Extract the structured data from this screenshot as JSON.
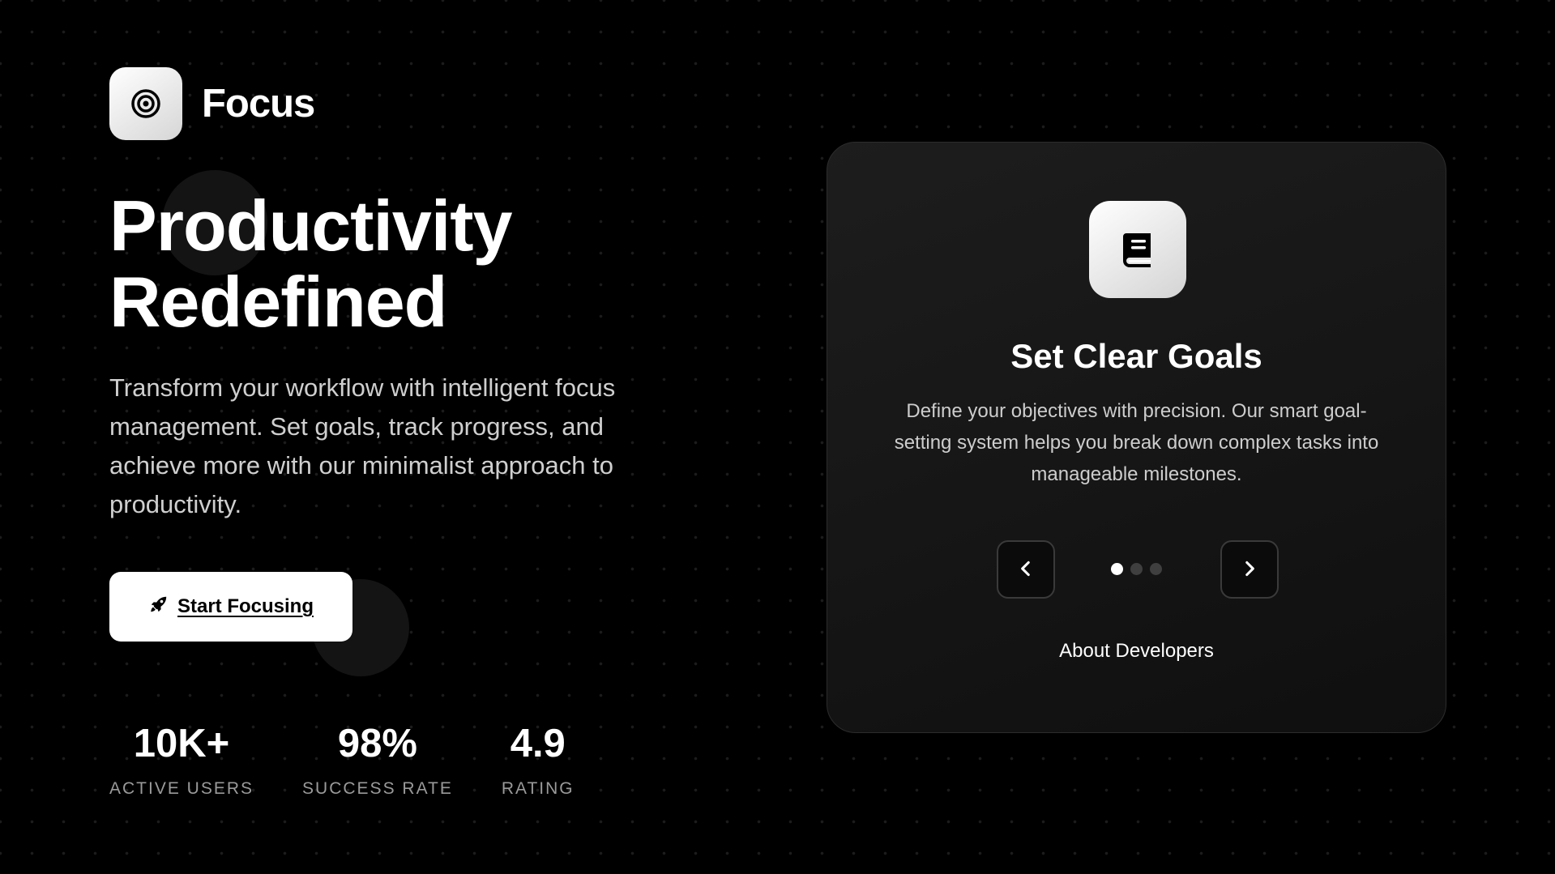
{
  "brand": {
    "name": "Focus",
    "logo_icon": "target-icon"
  },
  "hero": {
    "title_line1": "Productivity",
    "title_line2": "Redefined",
    "description": "Transform your workflow with intelligent focus management. Set goals, track progress, and achieve more with our minimalist approach to productivity.",
    "cta_label": "Start Focusing",
    "cta_icon": "rocket-icon"
  },
  "stats": [
    {
      "value": "10K+",
      "label": "ACTIVE USERS"
    },
    {
      "value": "98%",
      "label": "SUCCESS RATE"
    },
    {
      "value": "4.9",
      "label": "RATING"
    }
  ],
  "feature_card": {
    "icon": "book-icon",
    "title": "Set Clear Goals",
    "description": "Define your objectives with precision. Our smart goal-setting system helps you break down complex tasks into manageable milestones.",
    "prev_icon": "chevron-left-icon",
    "next_icon": "chevron-right-icon",
    "slide_count": 3,
    "active_slide": 1,
    "footer_link": "About Developers"
  },
  "colors": {
    "background": "#000000",
    "card_background": "#161616",
    "accent": "#ffffff",
    "muted_text": "#9a9a9a"
  }
}
